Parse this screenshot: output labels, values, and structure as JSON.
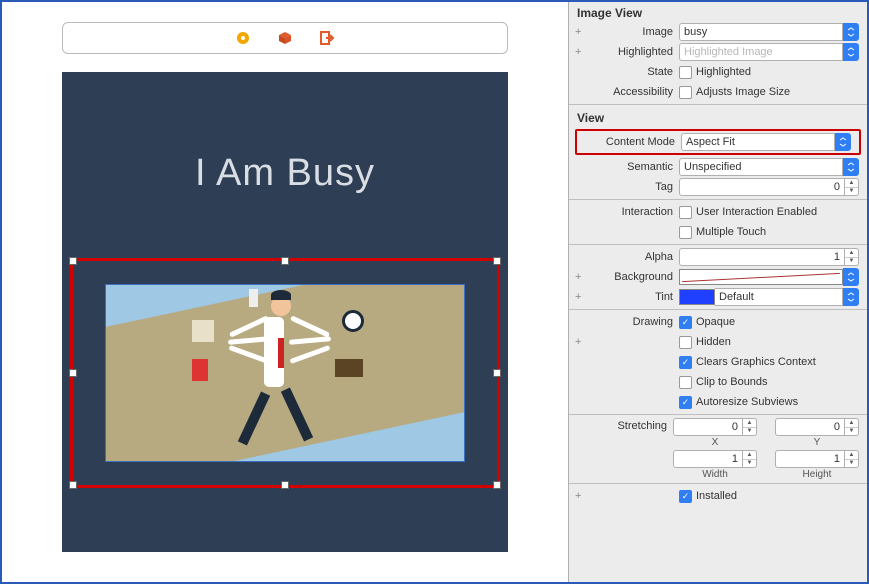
{
  "canvas": {
    "title": "I Am Busy"
  },
  "inspector": {
    "image_view_header": "Image View",
    "image_label": "Image",
    "image_value": "busy",
    "highlighted_label": "Highlighted",
    "highlighted_placeholder": "Highlighted Image",
    "state_label": "State",
    "state_option": "Highlighted",
    "accessibility_label": "Accessibility",
    "accessibility_option": "Adjusts Image Size",
    "view_header": "View",
    "content_mode_label": "Content Mode",
    "content_mode_value": "Aspect Fit",
    "semantic_label": "Semantic",
    "semantic_value": "Unspecified",
    "tag_label": "Tag",
    "tag_value": "0",
    "interaction_label": "Interaction",
    "interaction_opt1": "User Interaction Enabled",
    "interaction_opt2": "Multiple Touch",
    "alpha_label": "Alpha",
    "alpha_value": "1",
    "background_label": "Background",
    "tint_label": "Tint",
    "tint_value": "Default",
    "drawing_label": "Drawing",
    "drawing_opts": {
      "opaque": "Opaque",
      "hidden": "Hidden",
      "clears": "Clears Graphics Context",
      "clip": "Clip to Bounds",
      "autoresize": "Autoresize Subviews"
    },
    "stretching_label": "Stretching",
    "stretch_x": "0",
    "stretch_x_lab": "X",
    "stretch_y": "0",
    "stretch_y_lab": "Y",
    "stretch_w": "1",
    "stretch_w_lab": "Width",
    "stretch_h": "1",
    "stretch_h_lab": "Height",
    "installed_label": "Installed"
  }
}
